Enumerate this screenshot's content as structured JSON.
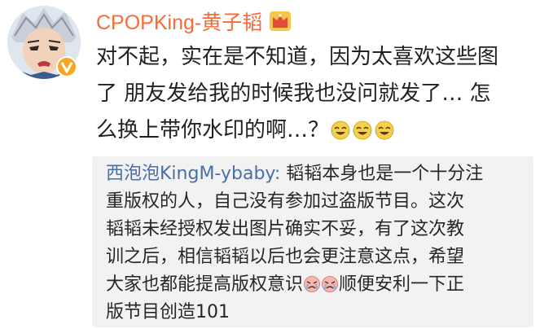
{
  "comment": {
    "username": "CPOPKing-黄子韬",
    "avatar_icon": "avatar-anime-character",
    "badge_icon": "verified-v-badge",
    "crown_icon": "vip-crown-icon",
    "username_color": "#f86b35",
    "text_lines": [
      "对不起，实在是不知道，因为太喜欢这些图",
      "了 朋友发给我的时候我也没问就发了… 怎",
      "么换上带你水印的啊…？"
    ],
    "trailing_emoji": [
      "laugh-cry-emoji",
      "laugh-cry-emoji",
      "laugh-cry-emoji"
    ]
  },
  "quote": {
    "author": "西泡泡KingM-ybaby:",
    "author_color": "#4a6fa5",
    "first_line_text": " 韬韬本身也是一个十分注",
    "lines": [
      "重版权的人，自己没有参加过盗版节目。这次",
      "韬韬未经授权发出图片确实不妥，有了这次教",
      "训之后，相信韬韬以后也会更注意这点，希望"
    ],
    "line5_before_emoji": "大家也都能提高版权意识",
    "line5_emoji": [
      "crying-emoji",
      "crying-emoji"
    ],
    "line5_after_emoji": "顺便安利一下正",
    "last_line": "版节目创造101",
    "background": "#f2f2f2"
  }
}
